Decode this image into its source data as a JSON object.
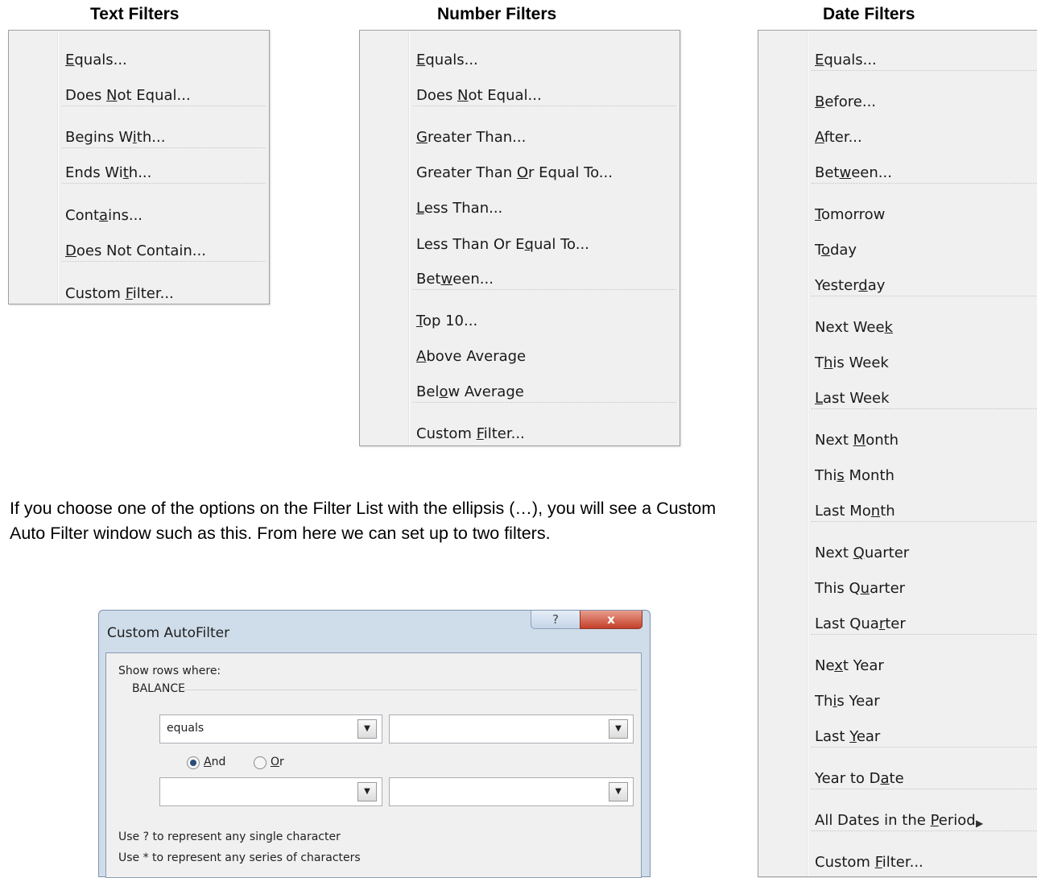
{
  "headings": {
    "text_filters": "Text Filters",
    "number_filters": "Number Filters",
    "date_filters": "Date Filters"
  },
  "text_menu": [
    {
      "pre": "",
      "key": "E",
      "post": "quals..."
    },
    {
      "pre": "Does ",
      "key": "N",
      "post": "ot Equal..."
    },
    {
      "pre": "Begins W",
      "key": "i",
      "post": "th..."
    },
    {
      "pre": "Ends Wi",
      "key": "t",
      "post": "h..."
    },
    {
      "pre": "Cont",
      "key": "a",
      "post": "ins..."
    },
    {
      "pre": "",
      "key": "D",
      "post": "oes Not Contain..."
    },
    {
      "pre": "Custom ",
      "key": "F",
      "post": "ilter..."
    }
  ],
  "number_menu": [
    {
      "pre": "",
      "key": "E",
      "post": "quals..."
    },
    {
      "pre": "Does ",
      "key": "N",
      "post": "ot Equal..."
    },
    {
      "pre": "",
      "key": "G",
      "post": "reater Than..."
    },
    {
      "pre": "Greater Than ",
      "key": "O",
      "post": "r Equal To..."
    },
    {
      "pre": "",
      "key": "L",
      "post": "ess Than..."
    },
    {
      "pre": "Less Than Or E",
      "key": "q",
      "post": "ual To..."
    },
    {
      "pre": "Bet",
      "key": "w",
      "post": "een..."
    },
    {
      "pre": "",
      "key": "T",
      "post": "op 10..."
    },
    {
      "pre": "",
      "key": "A",
      "post": "bove Average"
    },
    {
      "pre": "Bel",
      "key": "o",
      "post": "w Average"
    },
    {
      "pre": "Custom ",
      "key": "F",
      "post": "ilter..."
    }
  ],
  "date_menu": [
    {
      "pre": "",
      "key": "E",
      "post": "quals..."
    },
    {
      "pre": "",
      "key": "B",
      "post": "efore..."
    },
    {
      "pre": "",
      "key": "A",
      "post": "fter..."
    },
    {
      "pre": "Bet",
      "key": "w",
      "post": "een..."
    },
    {
      "pre": "",
      "key": "T",
      "post": "omorrow"
    },
    {
      "pre": "T",
      "key": "o",
      "post": "day"
    },
    {
      "pre": "Yester",
      "key": "d",
      "post": "ay"
    },
    {
      "pre": "Next Wee",
      "key": "k",
      "post": ""
    },
    {
      "pre": "T",
      "key": "h",
      "post": "is Week"
    },
    {
      "pre": "",
      "key": "L",
      "post": "ast Week"
    },
    {
      "pre": "Next ",
      "key": "M",
      "post": "onth"
    },
    {
      "pre": "Thi",
      "key": "s",
      "post": " Month"
    },
    {
      "pre": "Last Mo",
      "key": "n",
      "post": "th"
    },
    {
      "pre": "Next ",
      "key": "Q",
      "post": "uarter"
    },
    {
      "pre": "This Q",
      "key": "u",
      "post": "arter"
    },
    {
      "pre": "Last Qua",
      "key": "r",
      "post": "ter"
    },
    {
      "pre": "Ne",
      "key": "x",
      "post": "t Year"
    },
    {
      "pre": "Th",
      "key": "i",
      "post": "s Year"
    },
    {
      "pre": "Last ",
      "key": "Y",
      "post": "ear"
    },
    {
      "pre": "Year to D",
      "key": "a",
      "post": "te"
    },
    {
      "pre": "All Dates in the ",
      "key": "P",
      "post": "eriod"
    },
    {
      "pre": "Custom ",
      "key": "F",
      "post": "ilter..."
    }
  ],
  "paragraph": "If you choose one of the options on the Filter List with the ellipsis (…), you will see a Custom Auto Filter window such as this. From here we can set up to two filters.",
  "dialog": {
    "title": "Custom AutoFilter",
    "help_label": "?",
    "close_label": "x",
    "show_rows_where": "Show rows where:",
    "field_name": "BALANCE",
    "operator1_value": "equals",
    "value1": "",
    "operator2_value": "",
    "value2": "",
    "and_pre": "",
    "and_key": "A",
    "and_post": "nd",
    "or_pre": "",
    "or_key": "O",
    "or_post": "r",
    "hint1": "Use ? to represent any single character",
    "hint2": "Use * to represent any series of characters"
  }
}
